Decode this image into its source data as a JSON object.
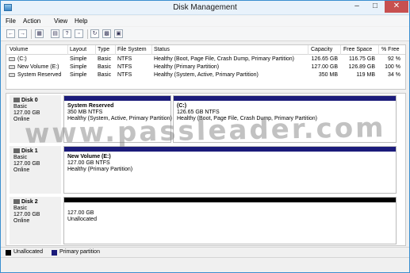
{
  "window": {
    "title": "Disk Management"
  },
  "menu": [
    "File",
    "Action",
    "View",
    "Help"
  ],
  "volume_list": {
    "columns": [
      "Volume",
      "Layout",
      "Type",
      "File System",
      "Status",
      "Capacity",
      "Free Space",
      "% Free"
    ],
    "rows": [
      [
        "(C:)",
        "Simple",
        "Basic",
        "NTFS",
        "Healthy (Boot, Page File, Crash Dump, Primary Partition)",
        "126.65 GB",
        "116.75 GB",
        "92 %"
      ],
      [
        "New Volume (E:)",
        "Simple",
        "Basic",
        "NTFS",
        "Healthy (Primary Partition)",
        "127.00 GB",
        "126.89 GB",
        "100 %"
      ],
      [
        "System Reserved",
        "Simple",
        "Basic",
        "NTFS",
        "Healthy (System, Active, Primary Partition)",
        "350 MB",
        "119 MB",
        "34 %"
      ]
    ]
  },
  "disks": [
    {
      "name": "Disk 0",
      "type": "Basic",
      "size": "127.00 GB",
      "state": "Online",
      "partitions": [
        {
          "title": "System Reserved",
          "size": "350 MB NTFS",
          "status": "Healthy (System, Active, Primary Partition)"
        },
        {
          "title": "(C:)",
          "size": "126.65 GB NTFS",
          "status": "Healthy (Boot, Page File, Crash Dump, Primary Partition)"
        }
      ]
    },
    {
      "name": "Disk 1",
      "type": "Basic",
      "size": "127.00 GB",
      "state": "Online",
      "partitions": [
        {
          "title": "New Volume (E:)",
          "size": "127.00 GB NTFS",
          "status": "Healthy (Primary Partition)"
        }
      ]
    },
    {
      "name": "Disk 2",
      "type": "Basic",
      "size": "127.00 GB",
      "state": "Online",
      "partitions": [
        {
          "title": "",
          "size": "127.00 GB",
          "status": "Unallocated"
        }
      ]
    }
  ],
  "legend": {
    "unallocated": "Unallocated",
    "primary": "Primary partition"
  },
  "watermark": "www.passleader.com",
  "colors": {
    "primary_partition": "#1b1b7a",
    "unallocated": "#000000",
    "title_bar": "#e8f2fb",
    "close_button": "#c75050"
  }
}
